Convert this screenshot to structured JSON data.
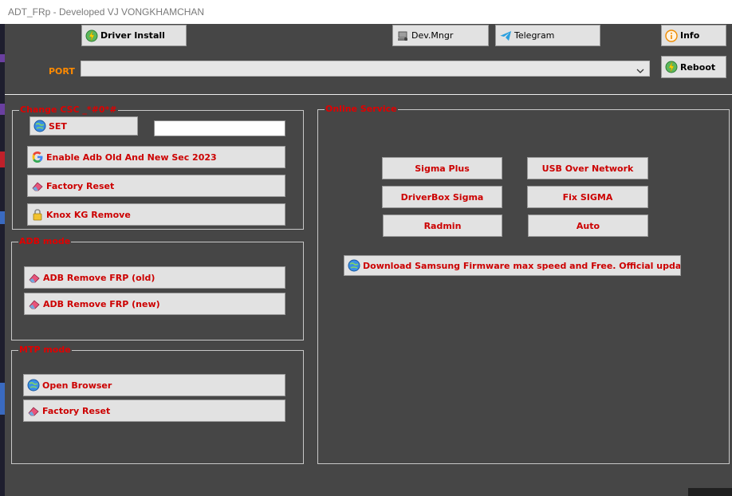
{
  "window": {
    "title": "ADT_FRp - Developed VJ VONGKHAMCHAN"
  },
  "toolbar": {
    "driver_install": "Driver Install",
    "dev_mngr": "Dev.Mngr",
    "telegram": "Telegram",
    "info": "Info",
    "reboot": "Reboot"
  },
  "port": {
    "label": "PORT",
    "value": ""
  },
  "change_csc": {
    "legend": "Change CSC _*#0*#",
    "set_label": "SET",
    "csc_value": "",
    "enable_adb": "Enable Adb Old And New Sec 2023",
    "factory_reset": "Factory Reset",
    "knox_remove": "Knox KG Remove"
  },
  "adb_mode": {
    "legend": "ADB mode",
    "remove_frp_old": "ADB Remove FRP (old)",
    "remove_frp_new": "ADB Remove FRP (new)"
  },
  "mtp_mode": {
    "legend": "MTP mode",
    "open_browser": "Open Browser",
    "factory_reset": "Factory Reset"
  },
  "online_service": {
    "legend": "Online Service",
    "sigma_plus": "Sigma Plus",
    "usb_over_network": "USB Over Network",
    "driverbox_sigma": "DriverBox Sigma",
    "fix_sigma": "Fix SIGMA",
    "radmin": "Radmin",
    "auto": "Auto",
    "download_firmware": "Download Samsung Firmware max speed and Free. Official update"
  },
  "colors": {
    "background": "#464646",
    "legend_red": "#e00000",
    "port_orange": "#ff8a00",
    "button_face": "#e2e2e2"
  },
  "icons": {
    "driver_install": "lightning-gear-icon",
    "dev_mngr": "device-manager-icon",
    "telegram": "telegram-icon",
    "info": "info-icon",
    "reboot": "reboot-icon",
    "set": "globe-icon",
    "enable_adb": "google-icon",
    "factory_reset": "eraser-icon",
    "knox": "lock-icon",
    "browser": "globe-icon"
  }
}
